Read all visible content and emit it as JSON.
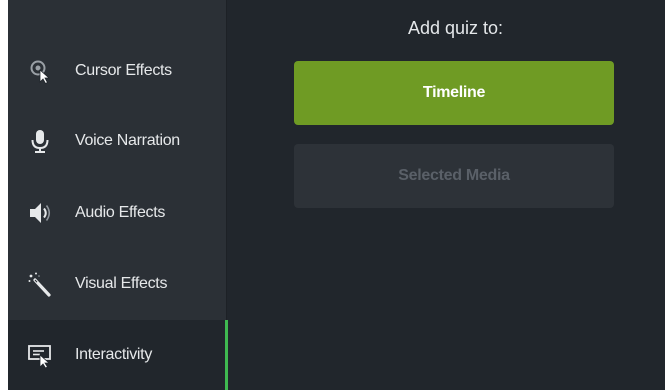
{
  "sidebar": {
    "items": [
      {
        "label": "Cursor Effects",
        "icon": "cursor-effects-icon"
      },
      {
        "label": "Voice Narration",
        "icon": "microphone-icon"
      },
      {
        "label": "Audio Effects",
        "icon": "speaker-icon"
      },
      {
        "label": "Visual Effects",
        "icon": "magic-wand-icon"
      },
      {
        "label": "Interactivity",
        "icon": "interactivity-icon",
        "active": true
      }
    ]
  },
  "main": {
    "heading": "Add quiz to:",
    "timeline_button": "Timeline",
    "selected_media_button": "Selected Media"
  },
  "colors": {
    "accent_green": "#6f9b24",
    "active_indicator": "#3fb950",
    "background": "#21262c",
    "sidebar": "#2b3036"
  }
}
